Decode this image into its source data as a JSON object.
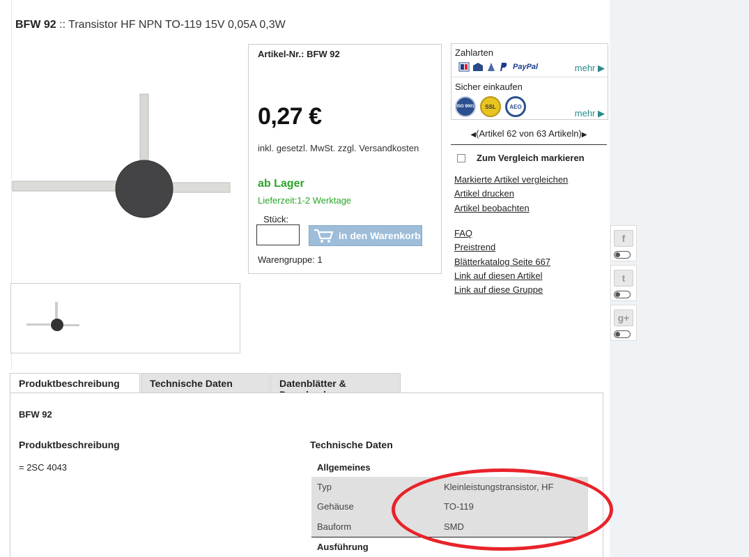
{
  "title": {
    "code": "BFW 92",
    "separator": " :: ",
    "name": "Transistor HF NPN TO-119 15V 0,05A 0,3W"
  },
  "buy": {
    "artnr": "Artikel-Nr.: BFW 92",
    "price": "0,27 €",
    "vat": "inkl. gesetzl. MwSt. zzgl. Versandkosten",
    "stock": "ab Lager",
    "delivery": "Lieferzeit:1-2 Werktage",
    "qty_label": "Stück:",
    "qty_value": "",
    "cart_label": "in den Warenkorb",
    "group": "Warengruppe: 1"
  },
  "payment": {
    "title": "Zahlarten",
    "paypal": "PayPal",
    "more": "mehr ▶",
    "secure_title": "Sicher einkaufen",
    "seals": [
      "ISO 9001",
      "SSL",
      "AEO"
    ],
    "secure_more": "mehr ▶"
  },
  "nav": {
    "prev": "◀",
    "text": "(Artikel 62 von 63 Artikeln)",
    "next": "▶"
  },
  "compare": {
    "label": "Zum Vergleich markieren"
  },
  "links1": [
    "Markierte Artikel vergleichen",
    "Artikel drucken",
    "Artikel beobachten"
  ],
  "links2": [
    "FAQ",
    "Preistrend",
    "Blätterkatalog Seite 667",
    "Link auf diesen Artikel",
    "Link auf diese Gruppe"
  ],
  "social": [
    {
      "icon": "facebook-icon",
      "glyph": "f"
    },
    {
      "icon": "twitter-icon",
      "glyph": "t"
    },
    {
      "icon": "googleplus-icon",
      "glyph": "g+"
    }
  ],
  "tabs": [
    "Produktbeschreibung",
    "Technische Daten",
    "Datenblätter & Downloads"
  ],
  "panel": {
    "code": "BFW 92",
    "desc_heading": "Produktbeschreibung",
    "desc": "= 2SC 4043",
    "tech_heading": "Technische Daten",
    "group1": "Allgemeines",
    "rows": [
      {
        "key": "Typ",
        "value": "Kleinleistungstransistor, HF"
      },
      {
        "key": "Gehäuse",
        "value": "TO-119"
      },
      {
        "key": "Bauform",
        "value": "SMD"
      }
    ],
    "group2": "Ausführung"
  },
  "colors": {
    "stock_green": "#2aa52a",
    "button_blue": "#9dbdd9",
    "highlight_red": "#e8232a",
    "link_teal": "#2a8a8a"
  }
}
